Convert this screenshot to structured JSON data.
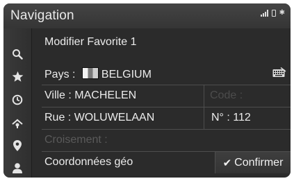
{
  "header": {
    "title": "Navigation",
    "status_icons": [
      "signal-icon",
      "phone-icon",
      "bluetooth-icon"
    ]
  },
  "sidebar": {
    "items": [
      {
        "icon": "search-icon"
      },
      {
        "icon": "star-icon"
      },
      {
        "icon": "clock-icon"
      },
      {
        "icon": "route-icon"
      },
      {
        "icon": "map-pin-icon"
      },
      {
        "icon": "person-icon"
      }
    ]
  },
  "form": {
    "heading": "Modifier Favorite 1",
    "country_label": "Pays : ",
    "country_value": "BELGIUM",
    "city_label": "Ville : MACHELEN",
    "code_label": "Code :",
    "street_label": "Rue : WOLUWELAAN",
    "number_label": "N° : 112",
    "crossing_label": "Croisement :",
    "coords_label": "Coordonnées géo",
    "confirm_label": "Confirmer"
  }
}
